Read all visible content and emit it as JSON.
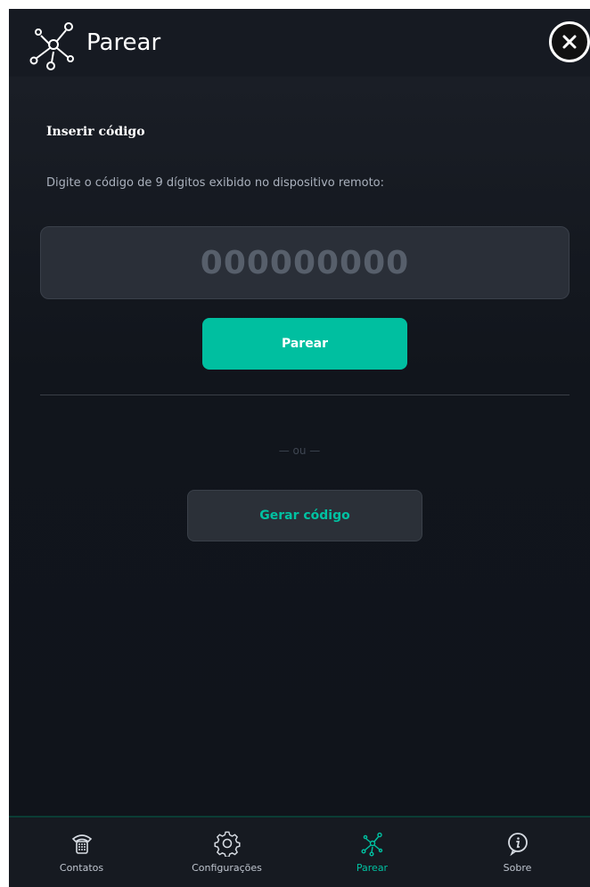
{
  "header": {
    "title": "Parear",
    "icon": "network-pair-icon",
    "close_icon": "close-icon"
  },
  "main": {
    "section_title": "Inserir código",
    "instruction": "Digite o código de 9 dígitos exibido no dispositivo remoto:",
    "code_input": {
      "value": "",
      "placeholder": "000000000"
    },
    "pair_button_label": "Parear",
    "or_text": "— ou —",
    "generate_button_label": "Gerar código"
  },
  "bottom_nav": {
    "items": [
      {
        "label": "Contatos",
        "icon": "phone-icon",
        "active": false
      },
      {
        "label": "Configurações",
        "icon": "gear-icon",
        "active": false
      },
      {
        "label": "Parear",
        "icon": "network-pair-icon",
        "active": true
      },
      {
        "label": "Sobre",
        "icon": "info-icon",
        "active": false
      }
    ]
  },
  "colors": {
    "accent": "#00bfa0",
    "background": "#11151c",
    "panel": "#2a2f38"
  }
}
